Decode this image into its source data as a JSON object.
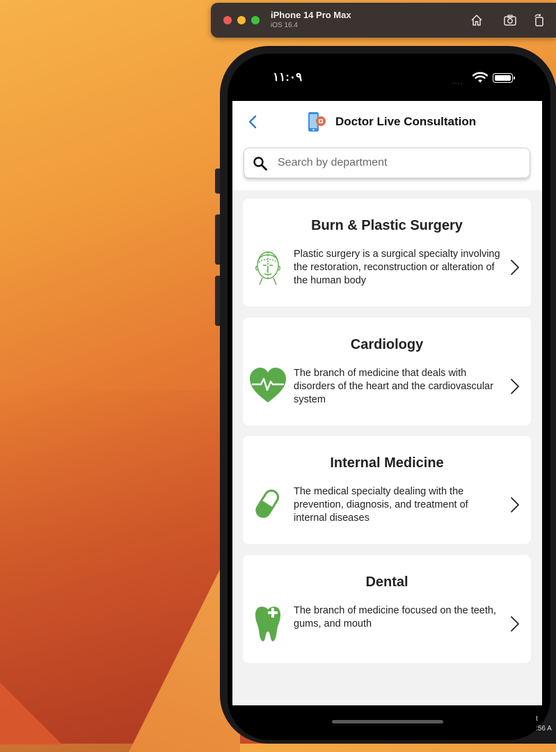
{
  "simulator": {
    "device_name": "iPhone 14 Pro Max",
    "os_version": "iOS 16.4",
    "home_icon": "home-icon",
    "screenshot_icon": "camera-icon",
    "rotate_icon": "rotate-icon"
  },
  "status_bar": {
    "time": "١١:٠٩",
    "dots": "....",
    "wifi_icon": "wifi-icon",
    "battery_icon": "battery-icon"
  },
  "header": {
    "back_icon": "chevron-left-icon",
    "app_icon": "phone-chat-icon",
    "title": "Doctor Live Consultation"
  },
  "search": {
    "icon": "search-icon",
    "placeholder": "Search by department"
  },
  "departments": [
    {
      "title": "Burn & Plastic Surgery",
      "description": "Plastic surgery is a surgical specialty involving the restoration, reconstruction or alteration of the human body",
      "icon": "face-outline-icon"
    },
    {
      "title": "Cardiology",
      "description": "The branch of medicine that deals with disorders of the heart and the cardiovascular system",
      "icon": "heart-pulse-icon"
    },
    {
      "title": "Internal Medicine",
      "description": "The medical specialty dealing with the prevention, diagnosis, and treatment of internal diseases",
      "icon": "pill-capsule-icon"
    },
    {
      "title": "Dental",
      "description": "The branch of medicine focused on the teeth, gums, and mouth",
      "icon": "tooth-icon"
    }
  ],
  "colors": {
    "accent_blue": "#2f7ad6",
    "icon_green": "#5aaa4a",
    "card_bg": "#ffffff",
    "screen_bg": "#f2f2f2"
  },
  "desktop_corner_text": "t\n:56 A"
}
